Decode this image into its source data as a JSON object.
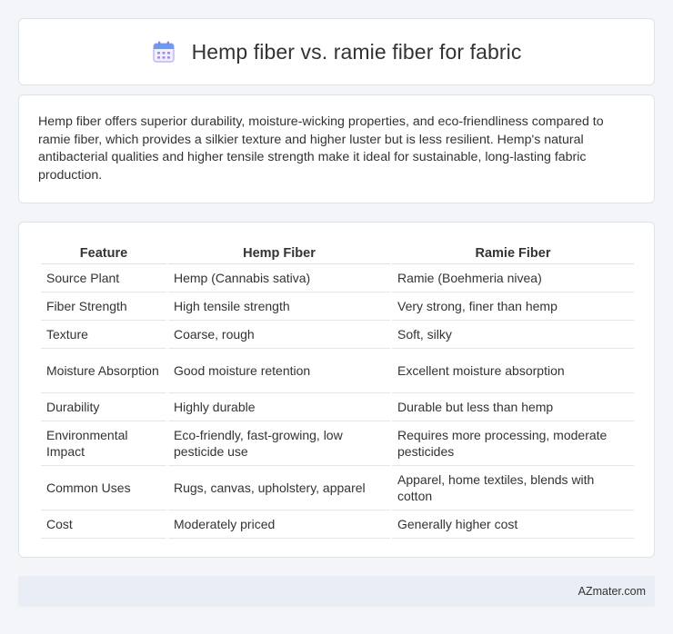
{
  "header": {
    "title": "Hemp fiber vs. ramie fiber for fabric",
    "icon": "calendar-icon"
  },
  "summary": {
    "text": "Hemp fiber offers superior durability, moisture-wicking properties, and eco-friendliness compared to ramie fiber, which provides a silkier texture and higher luster but is less resilient. Hemp's natural antibacterial qualities and higher tensile strength make it ideal for sustainable, long-lasting fabric production."
  },
  "table": {
    "headers": [
      "Feature",
      "Hemp Fiber",
      "Ramie Fiber"
    ],
    "rows": [
      [
        "Source Plant",
        "Hemp (Cannabis sativa)",
        "Ramie (Boehmeria nivea)"
      ],
      [
        "Fiber Strength",
        "High tensile strength",
        "Very strong, finer than hemp"
      ],
      [
        "Texture",
        "Coarse, rough",
        "Soft, silky"
      ],
      [
        "Moisture Absorption",
        "Good moisture retention",
        "Excellent moisture absorption"
      ],
      [
        "Durability",
        "Highly durable",
        "Durable but less than hemp"
      ],
      [
        "Environmental Impact",
        "Eco-friendly, fast-growing, low pesticide use",
        "Requires more processing, moderate pesticides"
      ],
      [
        "Common Uses",
        "Rugs, canvas, upholstery, apparel",
        "Apparel, home textiles, blends with cotton"
      ],
      [
        "Cost",
        "Moderately priced",
        "Generally higher cost"
      ]
    ]
  },
  "footer": {
    "brand": "AZmater.com"
  },
  "colors": {
    "icon_blue": "#6c9cf0",
    "icon_purple": "#a58ae8",
    "footer_bg": "#e8edf6"
  }
}
